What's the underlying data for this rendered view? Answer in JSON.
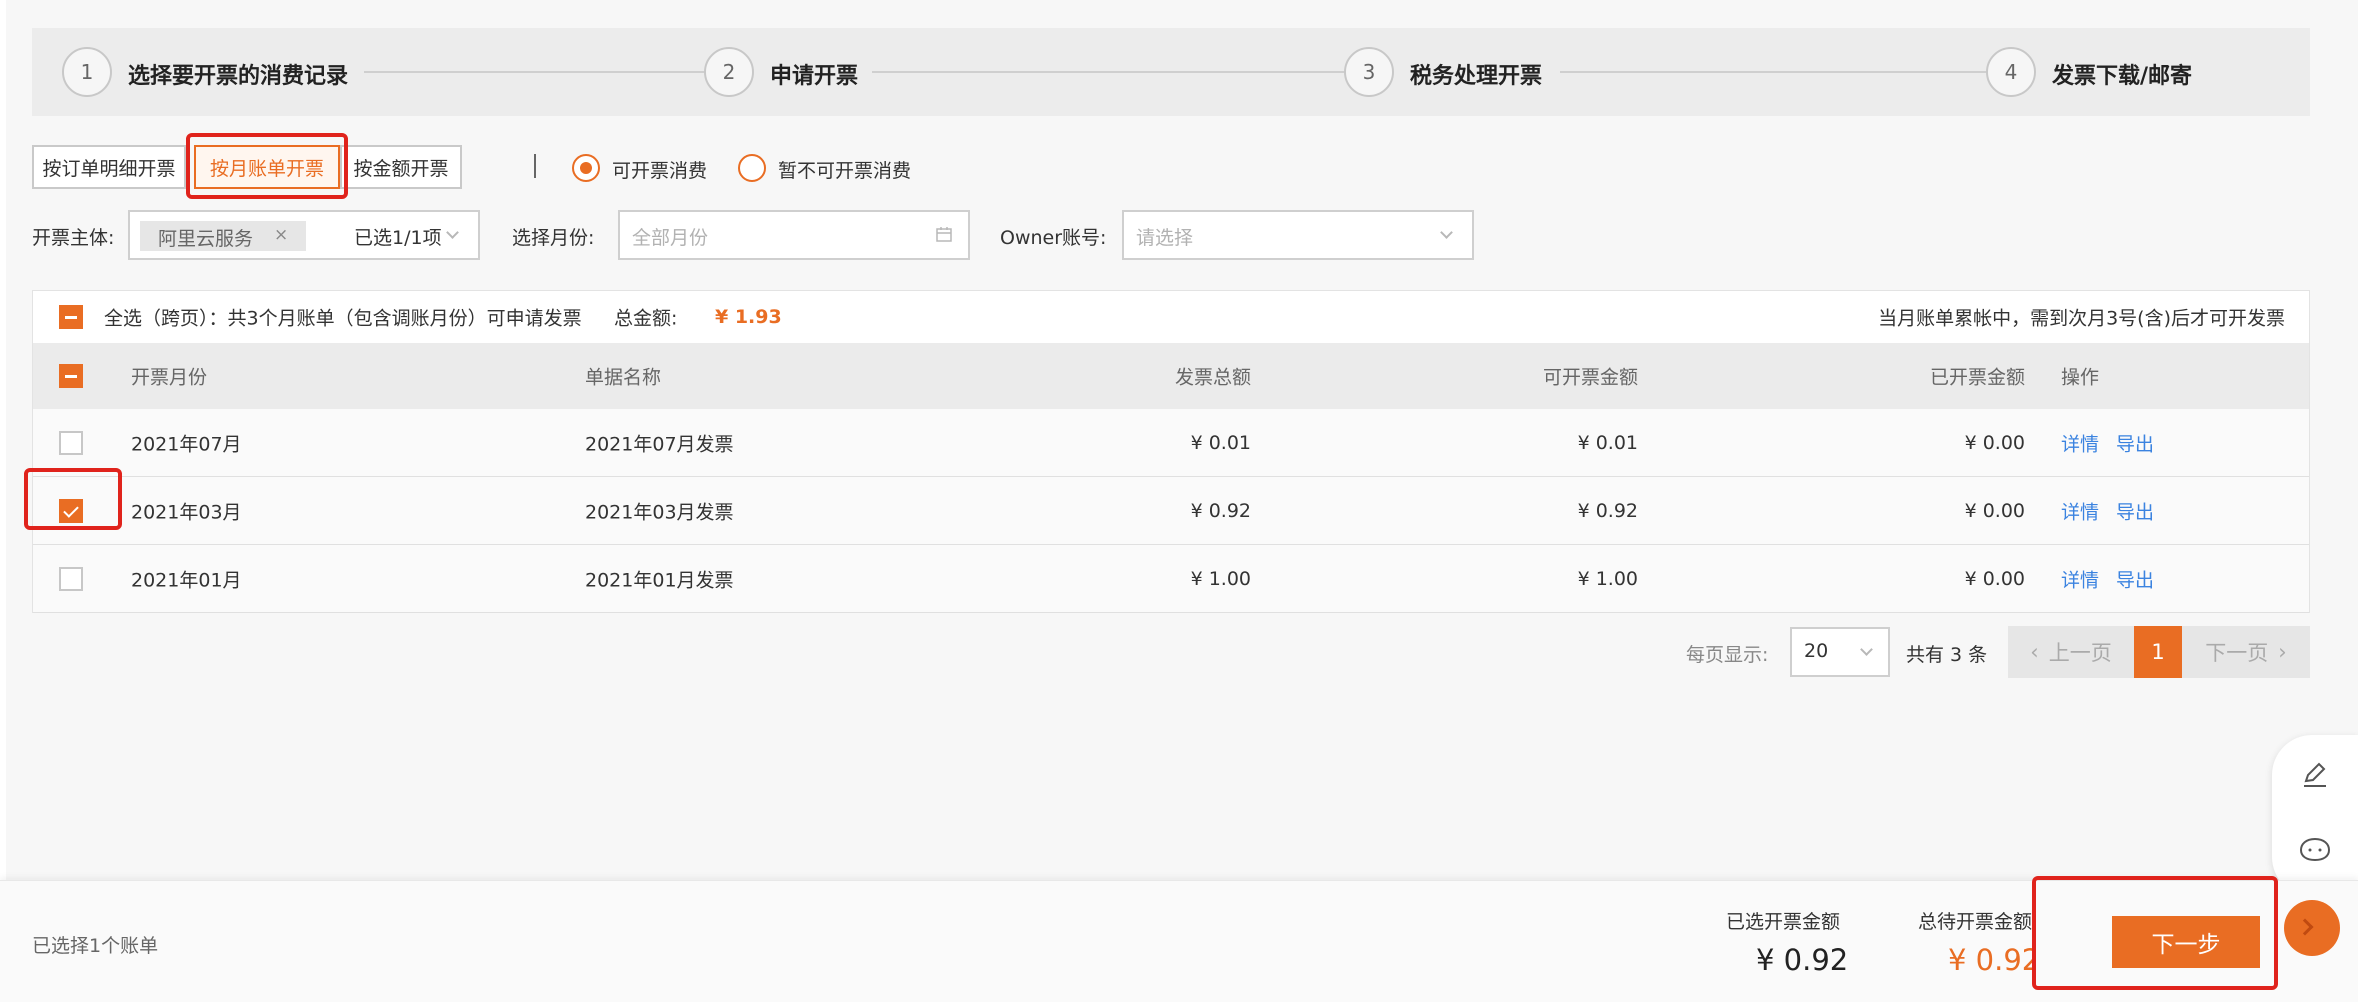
{
  "steps": [
    {
      "num": "1",
      "label": "选择要开票的消费记录"
    },
    {
      "num": "2",
      "label": "申请开票"
    },
    {
      "num": "3",
      "label": "税务处理开票"
    },
    {
      "num": "4",
      "label": "发票下载/邮寄"
    }
  ],
  "modes": [
    "按订单明细开票",
    "按月账单开票",
    "按金额开票"
  ],
  "radios": [
    "可开票消费",
    "暂不可开票消费"
  ],
  "filters": {
    "entity_label": "开票主体:",
    "entity_tag": "阿里云服务",
    "entity_tag_close": "×",
    "entity_selected": "已选1/1项",
    "month_label": "选择月份:",
    "month_placeholder": "全部月份",
    "owner_label": "Owner账号:",
    "owner_placeholder": "请选择"
  },
  "summary": {
    "select_all_text": "全选（跨页）：共3个月账单（包含调账月份）可申请发票",
    "total_label": "总金额:",
    "total_value": "¥ 1.93",
    "notice": "当月账单累帐中，需到次月3号(含)后才可开发票"
  },
  "table": {
    "headers": [
      "开票月份",
      "单据名称",
      "发票总额",
      "可开票金额",
      "已开票金额",
      "操作"
    ],
    "rows": [
      {
        "month": "2021年07月",
        "name": "2021年07月发票",
        "total": "¥ 0.01",
        "available": "¥ 0.01",
        "invoiced": "¥ 0.00",
        "detail": "详情",
        "export": "导出"
      },
      {
        "month": "2021年03月",
        "name": "2021年03月发票",
        "total": "¥ 0.92",
        "available": "¥ 0.92",
        "invoiced": "¥ 0.00",
        "detail": "详情",
        "export": "导出"
      },
      {
        "month": "2021年01月",
        "name": "2021年01月发票",
        "total": "¥ 1.00",
        "available": "¥ 1.00",
        "invoiced": "¥ 0.00",
        "detail": "详情",
        "export": "导出"
      }
    ]
  },
  "pagination": {
    "per_page_label": "每页显示:",
    "per_page_value": "20",
    "total_text": "共有 3 条",
    "prev": "上一页",
    "current": "1",
    "next": "下一页"
  },
  "bottom": {
    "selected_count": "已选择1个账单",
    "selected_amount_label": "已选开票金额",
    "selected_amount_value": "¥ 0.92",
    "pending_label": "总待开票金额",
    "pending_value": "¥ 0.92",
    "next_button": "下一步"
  },
  "colors": {
    "accent": "#e96d23",
    "link": "#3b83e0",
    "highlight": "#e0231c"
  }
}
